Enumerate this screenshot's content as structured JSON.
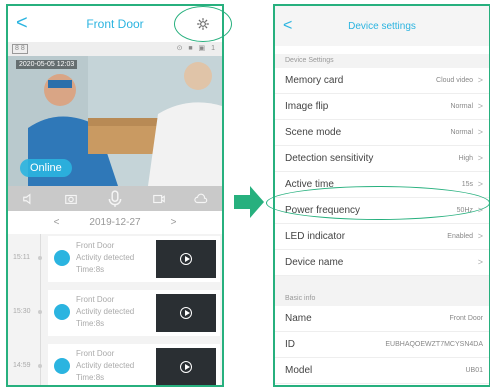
{
  "left": {
    "title": "Front Door",
    "back_glyph": "<",
    "status_left": "8 8",
    "status_right": "⊙ ■ ▣ 1",
    "timestamp": "2020-05-05  12:03",
    "online": "Online",
    "date_prev": "<",
    "date": "2019-12-27",
    "date_next": ">",
    "icons": [
      "speaker-icon",
      "camera-icon",
      "microphone-icon",
      "record-icon",
      "cloud-icon"
    ],
    "events": [
      {
        "time": "15:11",
        "line1": "Front Door",
        "line2": "Activity detected",
        "line3": "Time:8s"
      },
      {
        "time": "15:30",
        "line1": "Front Door",
        "line2": "Activity detected",
        "line3": "Time:8s"
      },
      {
        "time": "14:59",
        "line1": "Front Door",
        "line2": "Activity detected",
        "line3": "Time:8s"
      }
    ]
  },
  "right": {
    "title": "Device settings",
    "back_glyph": "<",
    "section1": "Device Settings",
    "rows": [
      {
        "label": "Memory card",
        "value": "Cloud video"
      },
      {
        "label": "Image flip",
        "value": "Normal"
      },
      {
        "label": "Scene mode",
        "value": "Normal"
      },
      {
        "label": "Detection sensitivity",
        "value": "High"
      },
      {
        "label": "Active time",
        "value": "15s"
      },
      {
        "label": "Power frequency",
        "value": "50Hz"
      },
      {
        "label": "LED indicator",
        "value": "Enabled"
      },
      {
        "label": "Device name",
        "value": ""
      }
    ],
    "section2": "Basic info",
    "info": [
      {
        "label": "Name",
        "value": "Front Door"
      },
      {
        "label": "ID",
        "value": "EUBHAQOEWZT7MCYSN4DA"
      },
      {
        "label": "Model",
        "value": "UB01"
      }
    ],
    "chevron": ">"
  },
  "colors": {
    "accent": "#2bb4e0",
    "annotation": "#27b07e"
  }
}
